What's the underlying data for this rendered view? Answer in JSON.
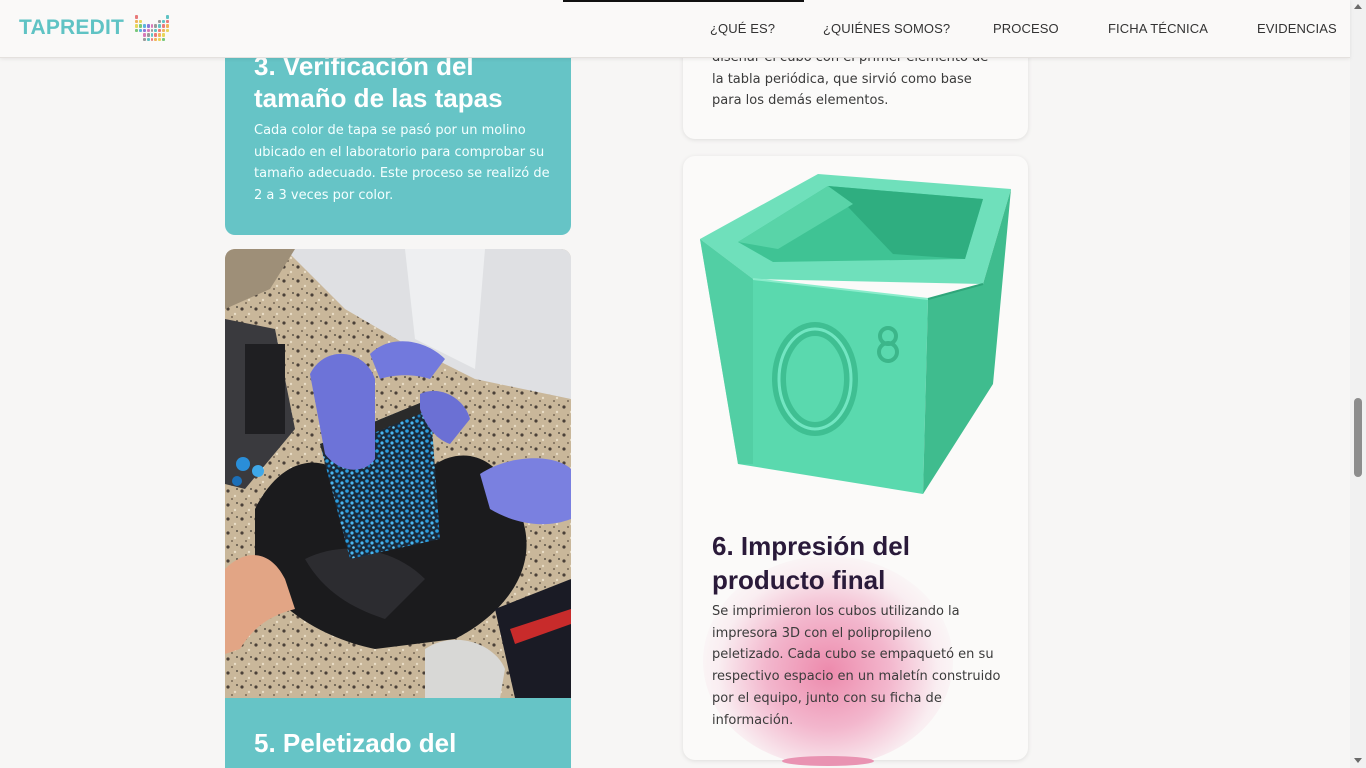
{
  "nav": {
    "brand": "TAPREDIT",
    "links": [
      "¿QUÉ ES?",
      "¿QUIÉNES SOMOS?",
      "PROCESO",
      "FICHA TÉCNICA",
      "EVIDENCIAS"
    ]
  },
  "steps": {
    "step3": {
      "title": "3. Verificación del tamaño de las tapas",
      "text": "Cada color de tapa se pasó por un molino ubicado en el laboratorio para comprobar su tamaño adecuado. Este proceso se realizó de 2 a 3 veces por color."
    },
    "step4_partial": {
      "text": "diseñar el cubo con el primer elemento de la tabla periódica, que sirvió como base para los demás elementos."
    },
    "step5": {
      "title": "5. Peletizado del"
    },
    "step6": {
      "title": "6. Impresión del producto final",
      "text": "Se imprimieron los cubos utilizando la impresora 3D con el polipropileno peletizado. Cada cubo se empaquetó en su respectivo espacio en un maletín construido por el equipo, junto con su ficha de información."
    },
    "cube": {
      "big_number": "0",
      "small_number": "8"
    }
  },
  "colors": {
    "accent_teal": "#66c4c6",
    "brand_text": "#5fc3c4",
    "heading_dark": "#2a1a3a",
    "cube_green": "#5fd9b0",
    "pink_blob": "#ec84a8"
  },
  "icons": {
    "logo": "periodic-table-icon"
  }
}
